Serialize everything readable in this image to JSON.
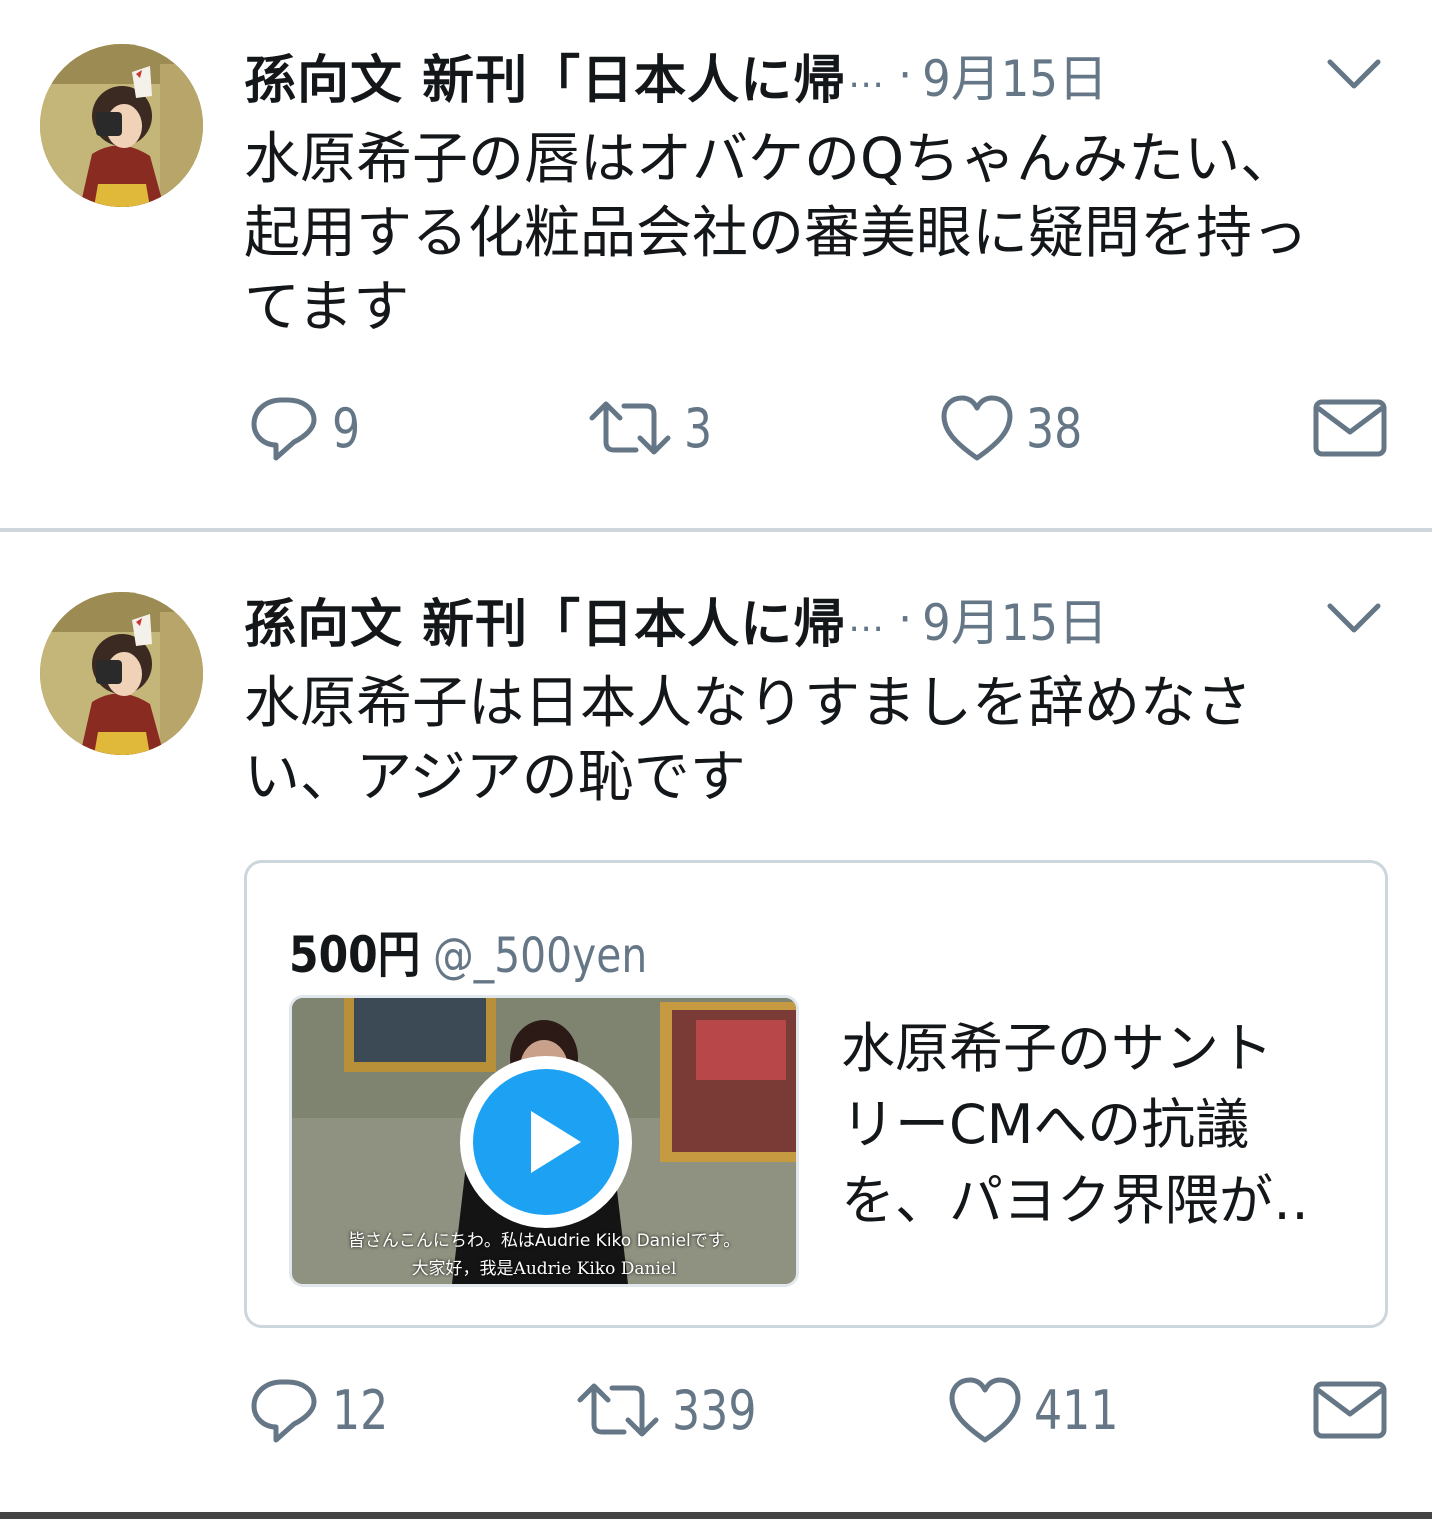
{
  "tweets": [
    {
      "name": "孫向文 新刊「日本人に帰",
      "ellipsis": "…",
      "dot": "·",
      "date": "9月15日",
      "text_lines": [
        "水原希子の唇はオバケのQちゃんみたい、",
        "起用する化粧品会社の審美眼に疑問を持っ",
        "てます"
      ],
      "reply_count": "9",
      "retweet_count": "3",
      "like_count": "38"
    },
    {
      "name": "孫向文 新刊「日本人に帰",
      "ellipsis": "…",
      "dot": "·",
      "date": "9月15日",
      "text_lines": [
        "水原希子は日本人なりすましを辞めなさ",
        "い、アジアの恥です"
      ],
      "quote": {
        "name": "500円",
        "handle": "@_500yen",
        "subtitle_jp": "皆さんこんにちわ。私はAudrie Kiko Danielです。",
        "subtitle_cn": "大家好，我是Audrie Kiko Daniel",
        "text_lines": [
          "水原希子のサント",
          "リーCMへの抗議",
          "を、パヨク界隈が‥"
        ]
      },
      "reply_count": "12",
      "retweet_count": "339",
      "like_count": "411"
    }
  ],
  "icons": {
    "reply": "reply-icon",
    "retweet": "retweet-icon",
    "like": "heart-icon",
    "dm": "mail-icon",
    "caret": "chevron-down-icon",
    "play": "play-icon"
  },
  "colors": {
    "accent": "#1da1f2",
    "secondary_text": "#657786",
    "divider": "#cfd6db"
  }
}
